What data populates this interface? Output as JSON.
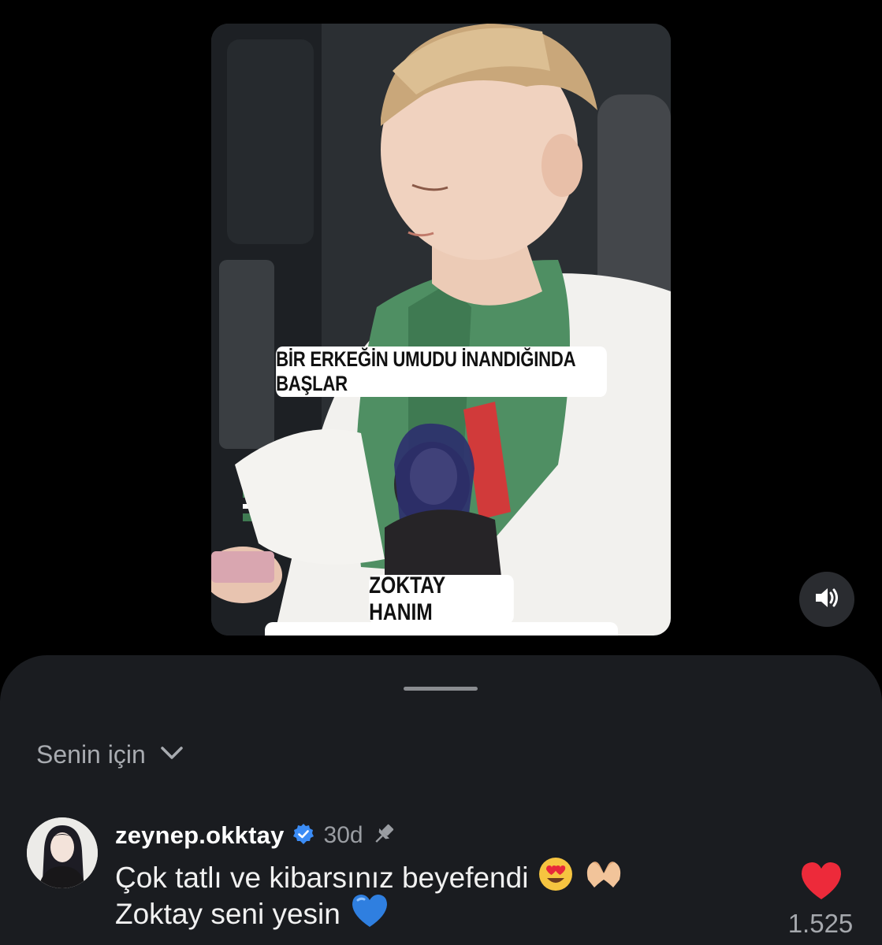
{
  "video": {
    "caption_top": "BİR ERKEĞİN UMUDU İNANDIĞINDA BAŞLAR",
    "caption_name": "ZOKTAY HANIM",
    "volume_icon": "speaker-volume-icon"
  },
  "comments_sheet": {
    "sort_label": "Senin için",
    "sort_icon": "chevron-down-icon"
  },
  "comment": {
    "username": "zeynep.okktay",
    "verified_icon": "verified-badge-icon",
    "age": "30d",
    "pin_icon": "pin-icon",
    "line1": "Çok tatlı ve kibarsınız beyefendi",
    "line2": "Zoktay seni yesin",
    "emojis": [
      "heart-eyes-emoji",
      "heart-hands-emoji",
      "blue-heart-emoji"
    ],
    "like_count": "1.525",
    "like_icon": "heart-icon",
    "like_color": "#ed2a3a"
  },
  "colors": {
    "background": "#000000",
    "sheet": "#1a1c20",
    "verified": "#3b8cf5"
  }
}
